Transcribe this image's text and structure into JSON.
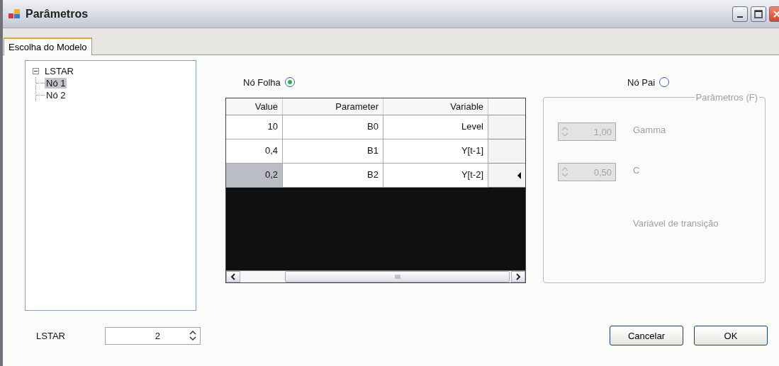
{
  "window": {
    "title": "Parâmetros"
  },
  "tabs": [
    {
      "label": "Escolha do Modelo",
      "selected": true
    }
  ],
  "tree": {
    "label": "LSTAR",
    "expanded": true,
    "children": [
      {
        "label": "Nó 1",
        "selected": true
      },
      {
        "label": "Nó 2",
        "selected": false
      }
    ]
  },
  "leaf_option": {
    "label": "Nó Folha",
    "selected": true
  },
  "table": {
    "columns": [
      "Value",
      "Parameter",
      "Variable"
    ],
    "rows": [
      {
        "cells": [
          "10",
          "B0",
          "Level"
        ],
        "selected": false
      },
      {
        "cells": [
          "0,4",
          "B1",
          "Y[t-1]"
        ],
        "selected": false
      },
      {
        "cells": [
          "0,2",
          "B2",
          "Y[t-2]"
        ],
        "selected": true
      }
    ]
  },
  "parent_option": {
    "label": "Nó Pai",
    "selected": false
  },
  "parameters_group": {
    "title": "Parâmetros (F)",
    "disabled": true,
    "fields": [
      {
        "value": "1,00",
        "label": "Gamma"
      },
      {
        "value": "0,50",
        "label": "C"
      }
    ],
    "note": "Variável de transição"
  },
  "lstar": {
    "label": "LSTAR",
    "value": "2"
  },
  "buttons": [
    "Cancelar",
    "OK"
  ]
}
